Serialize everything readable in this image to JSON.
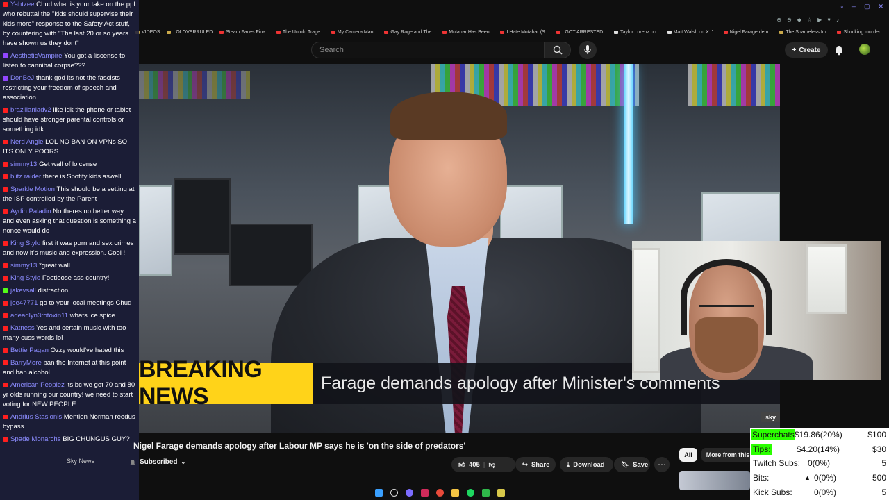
{
  "browser": {
    "bookmarks": [
      {
        "label": "VIDEOS",
        "icon": "folder-icon"
      },
      {
        "label": "LOLOVERRULED",
        "icon": "folder-icon"
      },
      {
        "label": "Steam Faces Fina...",
        "icon": "youtube-icon"
      },
      {
        "label": "The Untold Trage...",
        "icon": "youtube-icon"
      },
      {
        "label": "My Camera Man...",
        "icon": "youtube-icon"
      },
      {
        "label": "Gay Rage and The...",
        "icon": "youtube-icon"
      },
      {
        "label": "Mutahar Has Been...",
        "icon": "youtube-icon"
      },
      {
        "label": "I Hate Mutahar (S...",
        "icon": "youtube-icon"
      },
      {
        "label": "I GOT ARRESTED...",
        "icon": "youtube-icon"
      },
      {
        "label": "Taylor Lorenz on...",
        "icon": "x-icon"
      },
      {
        "label": "Matt Walsh on X: '...",
        "icon": "x-icon"
      },
      {
        "label": "Nigel Farage dem...",
        "icon": "youtube-icon"
      },
      {
        "label": "The Shameless Im...",
        "icon": "folder-icon"
      },
      {
        "label": "Shocking murder...",
        "icon": "youtube-icon"
      }
    ]
  },
  "youtube": {
    "search_placeholder": "Search",
    "create_label": "Create",
    "video_title": "Nigel Farage demands apology after Labour MP says he is 'on the side of predators'",
    "channel_name": "Sky News",
    "subscribed_label": "Subscribed",
    "likes": "405",
    "share_label": "Share",
    "download_label": "Download",
    "save_label": "Save",
    "chip_all": "All",
    "chip_more": "More from this"
  },
  "broadcast": {
    "breaking_label": "BREAKING NEWS",
    "headline": "Farage demands apology after Minister's comments",
    "logo": "sky"
  },
  "chat": [
    {
      "platform": "youtube",
      "user": "Yahtzee",
      "text": "Chud what is your take on the ppl who rebuttal the \"kids should supervise their kids more\" response to the Safety Act stuff, by countering with \"The last 20 or so years have shown us they dont\""
    },
    {
      "platform": "twitch",
      "user": "AestheticVampire",
      "text": "You got a liscense to listen to cannibal corpse???"
    },
    {
      "platform": "twitch",
      "user": "DonBeJ",
      "text": "thank god its not the fascists restricting your freedom of speech and association"
    },
    {
      "platform": "youtube",
      "user": "brazilianladv2",
      "text": "like idk the phone or tablet should have stronger parental controls or something idk"
    },
    {
      "platform": "youtube",
      "user": "Nerd Angle",
      "text": "LOL NO BAN ON VPNs SO ITS ONLY POORS"
    },
    {
      "platform": "youtube",
      "user": "simmy13",
      "text": "Get wall of loicense"
    },
    {
      "platform": "youtube",
      "user": "blitz raider",
      "text": "there is Spotify kids aswell"
    },
    {
      "platform": "youtube",
      "user": "Sparkle Motion",
      "text": "This should be a setting at the ISP controlled by the Parent"
    },
    {
      "platform": "youtube",
      "user": "Aydin Paladin",
      "text": "No theres no better way and even asking that question is something a nonce would do"
    },
    {
      "platform": "youtube",
      "user": "King Stylo",
      "text": "first it was porn and sex crimes and now it's music and expression. Cool !"
    },
    {
      "platform": "youtube",
      "user": "simmy13",
      "text": "*great wall"
    },
    {
      "platform": "youtube",
      "user": "King Stylo",
      "text": "Footloose ass country!"
    },
    {
      "platform": "kick",
      "user": "jakevsall",
      "text": "distraction"
    },
    {
      "platform": "youtube",
      "user": "joe47771",
      "text": "go to your local meetings Chud"
    },
    {
      "platform": "youtube",
      "user": "adeadlyn3rotoxin11",
      "text": "whats ice spice"
    },
    {
      "platform": "youtube",
      "user": "Katness",
      "text": "Yes and certain music with too many cuss words lol"
    },
    {
      "platform": "youtube",
      "user": "Bettie Pagan",
      "text": "Ozzy would've hated this"
    },
    {
      "platform": "youtube",
      "user": "BarryMore",
      "text": "ban the Internet at this point and ban alcohol"
    },
    {
      "platform": "youtube",
      "user": "American Peoplez",
      "text": "its bc we got 70 and 80 yr olds running our country! we need to start voting for NEW PEOPLE"
    },
    {
      "platform": "youtube",
      "user": "Andrius Stasionis",
      "text": "Mention Norman reedus bypass"
    },
    {
      "platform": "youtube",
      "user": "Spade Monarchs",
      "text": "BIG CHUNGUS GUY?"
    }
  ],
  "donations": {
    "superchats": {
      "label": "Superchats",
      "value": "$19.86(20%)",
      "goal": "$100"
    },
    "tips": {
      "label": "Tips:",
      "value": "$4.20(14%)",
      "goal": "$30"
    },
    "twitch_subs": {
      "label": "Twitch Subs:",
      "value": "0(0%)",
      "goal": "5"
    },
    "bits": {
      "label": "Bits:",
      "value": "0(0%)",
      "goal": "500"
    },
    "kick_subs": {
      "label": "Kick Subs:",
      "value": "0(0%)",
      "goal": "5"
    }
  },
  "colors": {
    "chat_bg": "#1e203c",
    "chat_username": "#8c8cff",
    "breaking_yellow": "#ffd319",
    "donation_highlight": "#2bff00"
  }
}
